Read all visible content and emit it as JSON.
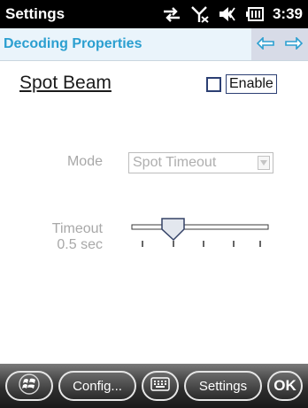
{
  "status_bar": {
    "title": "Settings",
    "time": "3:39",
    "icons": [
      "data-sync-icon",
      "no-signal-icon",
      "volume-icon",
      "battery-icon"
    ]
  },
  "title_bar": {
    "title": "Decoding Properties",
    "icons": [
      "back-arrow-icon",
      "forward-arrow-icon"
    ]
  },
  "section": {
    "title": "Spot Beam",
    "enable_label": "Enable",
    "enable_checked": false
  },
  "mode": {
    "label": "Mode",
    "value": "Spot Timeout"
  },
  "timeout": {
    "label": "Timeout",
    "value_text": "0.5 sec",
    "slider_tick_count": 5,
    "slider_position_tick": 1
  },
  "taskbar": {
    "start_icon": "windows-logo-icon",
    "config_label": "Config...",
    "keyboard_icon": "keyboard-icon",
    "settings_label": "Settings",
    "ok_label": "OK"
  },
  "colors": {
    "status_bar": "#000000",
    "title_text": "#2b9fd0",
    "title_bar_bg": "#eaf4fb",
    "nav_bg": "#d7dbe7",
    "disabled_text": "#a8a8a8"
  }
}
